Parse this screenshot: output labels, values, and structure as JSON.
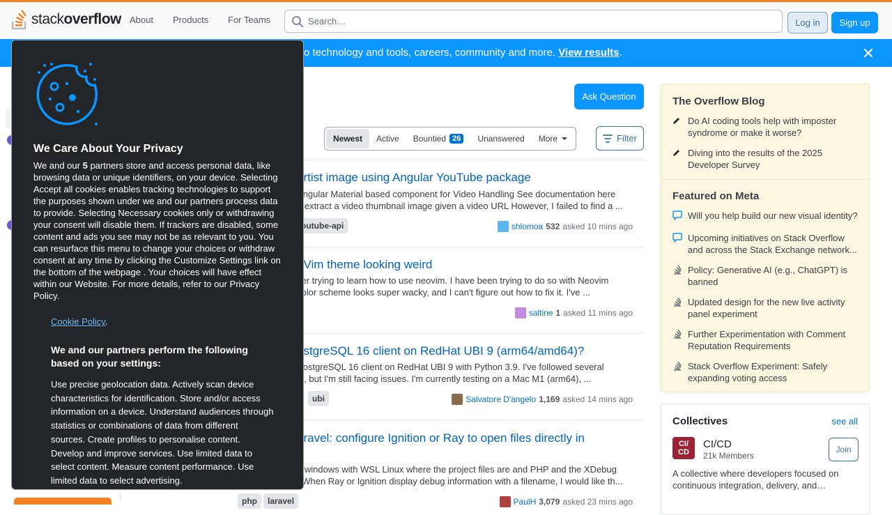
{
  "header": {
    "logo_text_light": "stack",
    "logo_text_bold": "overflow",
    "nav": [
      "About",
      "Products",
      "For Teams"
    ],
    "search_placeholder": "Search…",
    "login_label": "Log in",
    "signup_label": "Sign up"
  },
  "banner": {
    "text": "o technology and tools, careers, community and more. ",
    "link": "View results",
    "suffix": "."
  },
  "main": {
    "ask_label": "Ask Question",
    "tabs": [
      {
        "label": "Newest"
      },
      {
        "label": "Active"
      },
      {
        "label": "Bountied",
        "badge": "26"
      },
      {
        "label": "Unanswered"
      },
      {
        "label": "More"
      }
    ],
    "filter_label": "Filter",
    "questions": [
      {
        "title": "artist image using Angular YouTube package",
        "excerpt": [
          "Angular Material based component for Video Handling See documentation here",
          "n extract a video thumbnail image given a video URL However, I failed to find a ..."
        ],
        "tags": [
          "outube-api"
        ],
        "user": "shlomoa",
        "rep": "532",
        "time": "asked 10 mins ago",
        "avatar_color": "#5ab5f0"
      },
      {
        "title": "oVim theme looking weird",
        "excerpt": [
          "ser trying to learn how to use neovim. I have been trying to do so with Neovim",
          "color scheme looks super wacky, and I can't figure out how to fix it. I've ..."
        ],
        "tags": [],
        "user": "saltine",
        "rep": "1",
        "time": "asked 11 mins ago",
        "avatar_color": "#c58be0"
      },
      {
        "title": "ostgreSQL 16 client on RedHat UBI 9 (arm64/amd64)?",
        "excerpt": [
          "PostgreSQL 16 client on RedHat UBI 9 with Python 3.9. I've followed several",
          "ts, but I'm still facing issues. I'm currently testing on a Mac M1 (arm64), ..."
        ],
        "tags": [
          "ubi"
        ],
        "user": "Salvatore D'angelo",
        "rep": "1,169",
        "time": "asked 14 mins ago",
        "avatar_color": "#8b6a4e"
      },
      {
        "title": "aravel: configure Ignition or Ray to open files directly in",
        "excerpt": [
          "n windows with WSL Linux where the project files are and PHP and the XDebug",
          ". When Ray or Ignition display debug information with a filename, I would like th..."
        ],
        "tags": [
          "php",
          "laravel"
        ],
        "user": "PaulH",
        "rep": "3,079",
        "time": "asked 23 mins ago",
        "avatar_color": "#b04040"
      }
    ]
  },
  "sidebar": {
    "blog_title": "The Overflow Blog",
    "blog_items": [
      "Do AI coding tools help with imposter syndrome or make it worse?",
      "Diving into the results of the 2025 Developer Survey"
    ],
    "meta_title": "Featured on Meta",
    "meta_items": [
      {
        "icon": "comment-icon",
        "text": "Will you help build our new visual identity?"
      },
      {
        "icon": "comment-icon",
        "text": "Upcoming initiatives on Stack Overflow and across the Stack Exchange network..."
      },
      {
        "icon": "stack-exchange-icon",
        "text": "Policy: Generative AI (e.g., ChatGPT) is banned"
      },
      {
        "icon": "stack-exchange-icon",
        "text": "Updated design for the new live activity panel experiment"
      },
      {
        "icon": "stack-exchange-icon",
        "text": "Further Experimentation with Comment Reputation Requirements"
      },
      {
        "icon": "stack-exchange-icon",
        "text": "Stack Overflow Experiment: Safely expanding voting access"
      }
    ],
    "collectives": {
      "title": "Collectives",
      "see_all": "see all",
      "logo_line1": "CI/",
      "logo_line2": "CD",
      "name": "CI/CD",
      "members": "21k Members",
      "join_label": "Join",
      "description": "A collective where developers focused on continuous integration, delivery, and…"
    }
  },
  "privacy": {
    "title": "We Care About Your Privacy",
    "text_before": "We and our ",
    "partners_count": "5",
    "text_after": " partners store and access personal data, like browsing data or unique identifiers, on your device. Selecting Accept all cookies enables tracking technologies to support the purposes shown under we and our partners process data to provide. Selecting Necessary cookies only or withdrawing your consent will disable them. If trackers are disabled, some content and ads you see may not be as relevant to you. You can resurface this menu to change your choices or withdraw consent at any time by clicking the Customize Settings link on the bottom of the webpage . Your choices will have effect within our Website. For more details, refer to our Privacy Policy.",
    "cookie_link": "Cookie Policy",
    "cookie_dot": ".",
    "purposes_title": "We and our partners perform the following based on your settings:",
    "purposes_text": "Use precise geolocation data. Actively scan device characteristics for identification. Store and/or access information on a device. Understand audiences through statistics or combinations of data from different sources. Create profiles to personalise content. Develop and improve services. Use limited data to select content. Measure content performance. Use limited data to select advertising."
  },
  "colors": {
    "brand_orange": "#f48225",
    "primary_blue": "#0a95ff",
    "link_blue": "#0074cc",
    "modal_bg": "#232629",
    "blog_bg": "#fdf7e2"
  }
}
